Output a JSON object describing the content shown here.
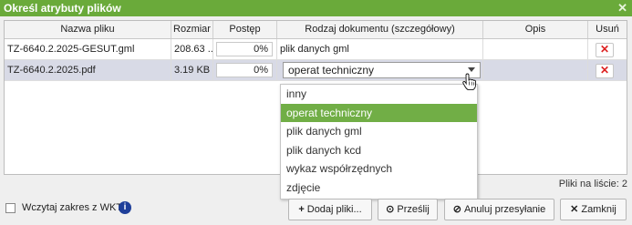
{
  "dialog": {
    "title": "Określ atrybuty plików"
  },
  "table": {
    "columns": [
      "Nazwa pliku",
      "Rozmiar",
      "Postęp",
      "Rodzaj dokumentu (szczegółowy)",
      "Opis",
      "Usuń"
    ],
    "rows": [
      {
        "name": "TZ-6640.2.2025-GESUT.gml",
        "size": "208.63 ...",
        "progress": "0%",
        "doc_type": "plik danych gml",
        "description": ""
      },
      {
        "name": "TZ-6640.2.2025.pdf",
        "size": "3.19 KB",
        "progress": "0%",
        "doc_type": "operat techniczny",
        "description": ""
      }
    ],
    "count_text": "Pliki na liście: 2"
  },
  "dropdown": {
    "selected": "operat techniczny",
    "options": [
      "inny",
      "operat techniczny",
      "plik danych gml",
      "plik danych kcd",
      "wykaz współrzędnych",
      "zdjęcie"
    ]
  },
  "footer": {
    "checkbox_label": "Wczytaj zakres z WKT",
    "checkbox_checked": false,
    "buttons": {
      "add": "Dodaj pliki...",
      "send": "Prześlij",
      "cancel": "Anuluj przesyłanie",
      "close": "Zamknij"
    }
  },
  "colors": {
    "title_bar": "#6aaa3a",
    "option_highlight": "#71ae46",
    "selected_row": "#d8dae6",
    "delete_x": "#dd2222"
  }
}
